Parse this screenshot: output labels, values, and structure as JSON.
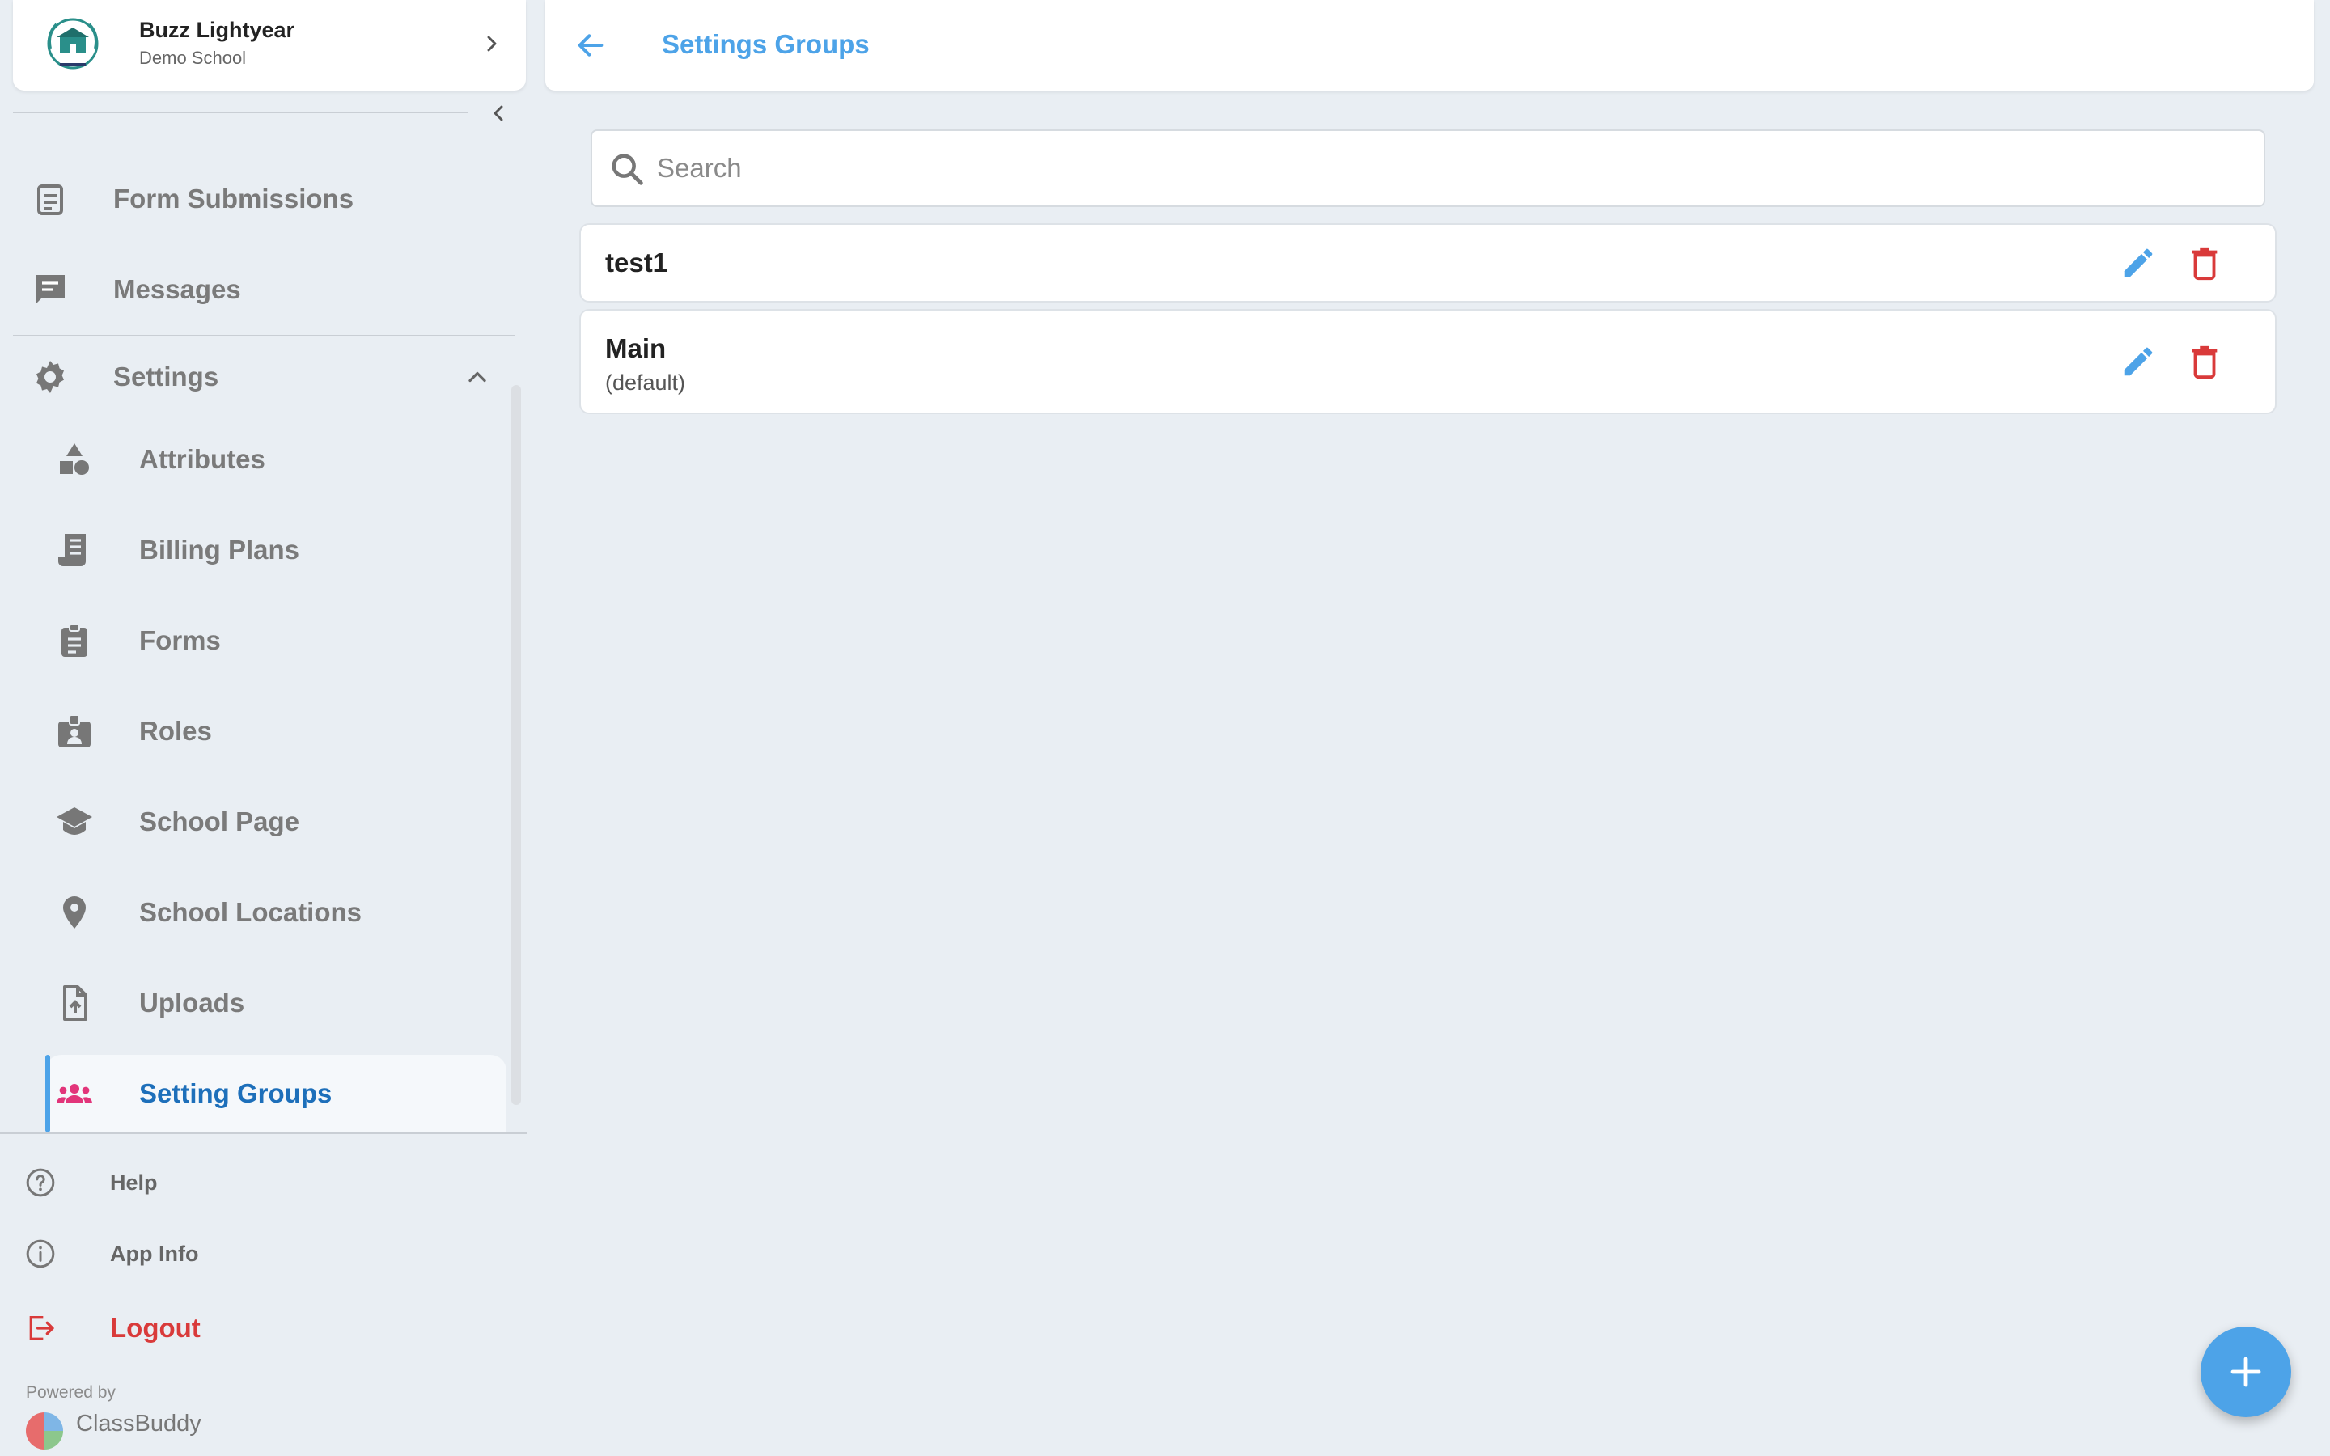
{
  "profile": {
    "name": "Buzz Lightyear",
    "school": "Demo School"
  },
  "nav": {
    "form_submissions": "Form Submissions",
    "messages": "Messages",
    "settings": "Settings",
    "sub_items": [
      "Attributes",
      "Billing Plans",
      "Forms",
      "Roles",
      "School Page",
      "School Locations",
      "Uploads",
      "Setting Groups"
    ]
  },
  "footer": {
    "help": "Help",
    "app_info": "App Info",
    "logout": "Logout",
    "powered_by": "Powered by",
    "brand": "ClassBuddy"
  },
  "header": {
    "title": "Settings Groups"
  },
  "search": {
    "placeholder": "Search"
  },
  "groups": [
    {
      "name": "test1",
      "subtitle": ""
    },
    {
      "name": "Main",
      "subtitle": "(default)"
    }
  ],
  "colors": {
    "accent": "#4da3e8",
    "active_text": "#1d6fba",
    "danger": "#d93a3a",
    "active_icon": "#e2357a"
  }
}
